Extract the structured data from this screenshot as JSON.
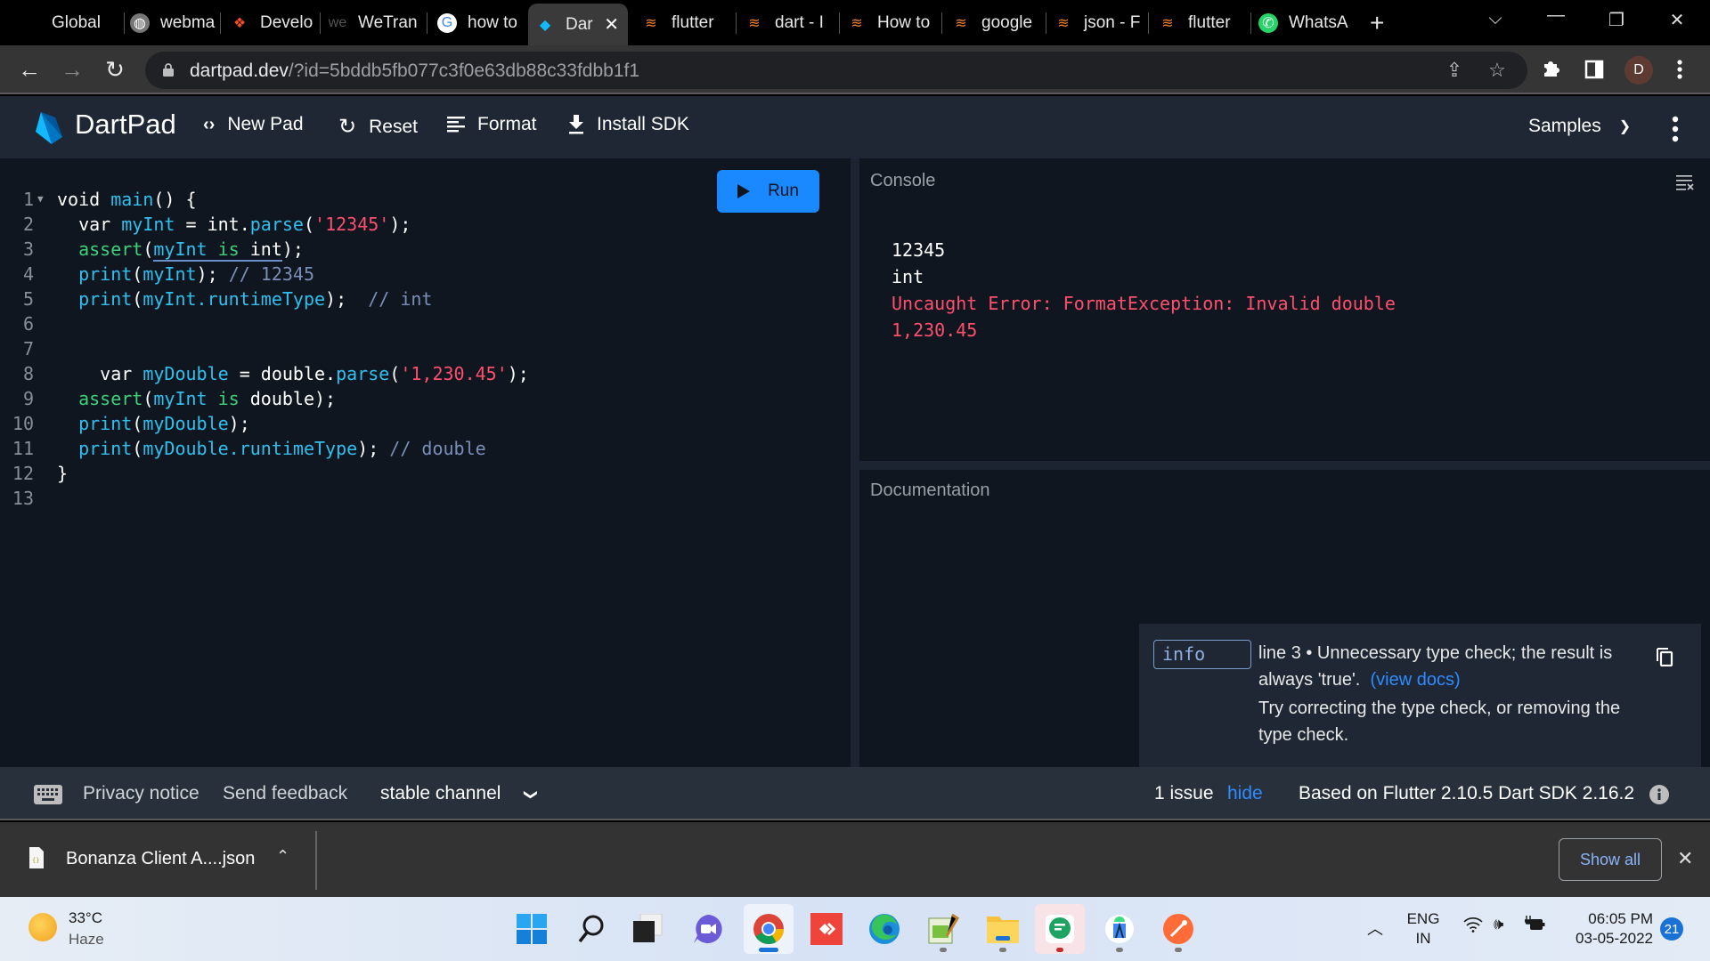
{
  "browser": {
    "tabs": [
      {
        "title": "Global",
        "icon": "none"
      },
      {
        "title": "webma",
        "icon": "globe-icon"
      },
      {
        "title": "Develo",
        "icon": "figma-icon"
      },
      {
        "title": "WeTran",
        "icon": "wetransfer-icon"
      },
      {
        "title": "how to",
        "icon": "google-icon"
      },
      {
        "title": "Dar",
        "icon": "dart-icon",
        "active": true
      },
      {
        "title": "flutter",
        "icon": "stackoverflow-icon"
      },
      {
        "title": "dart - I",
        "icon": "stackoverflow-icon"
      },
      {
        "title": "How to",
        "icon": "stackoverflow-icon"
      },
      {
        "title": "google",
        "icon": "stackoverflow-icon"
      },
      {
        "title": "json - F",
        "icon": "stackoverflow-icon"
      },
      {
        "title": "flutter",
        "icon": "stackoverflow-icon"
      },
      {
        "title": "WhatsA",
        "icon": "whatsapp-icon"
      }
    ],
    "new_tab": "+",
    "url_host": "dartpad.dev",
    "url_rest": "/?id=5bddb5fb077c3f0e63db88c33fdbb1f1",
    "profile_initial": "D"
  },
  "header": {
    "app_name": "DartPad",
    "buttons": {
      "new_pad": "New Pad",
      "reset": "Reset",
      "format": "Format",
      "install_sdk": "Install SDK"
    },
    "samples": "Samples"
  },
  "editor": {
    "run_label": "Run",
    "line_numbers": [
      "1",
      "2",
      "3",
      "4",
      "5",
      "6",
      "7",
      "8",
      "9",
      "10",
      "11",
      "12",
      "13"
    ],
    "lines": [
      [
        {
          "t": "void ",
          "c": "kw"
        },
        {
          "t": "main",
          "c": "fn"
        },
        {
          "t": "() {",
          "c": "kw"
        }
      ],
      [
        {
          "t": "  var ",
          "c": "kw"
        },
        {
          "t": "myInt",
          "c": "id"
        },
        {
          "t": " = int.",
          "c": "kw"
        },
        {
          "t": "parse",
          "c": "fn"
        },
        {
          "t": "(",
          "c": "kw"
        },
        {
          "t": "'12345'",
          "c": "str"
        },
        {
          "t": ");",
          "c": "kw"
        }
      ],
      [
        {
          "t": "  ",
          "c": "kw"
        },
        {
          "t": "assert",
          "c": "as"
        },
        {
          "t": "(",
          "c": "kw"
        },
        {
          "t": "myInt ",
          "c": "id sq"
        },
        {
          "t": "is ",
          "c": "as sq"
        },
        {
          "t": "int",
          "c": "kw sq"
        },
        {
          "t": ");",
          "c": "kw"
        }
      ],
      [
        {
          "t": "  print",
          "c": "fn"
        },
        {
          "t": "(",
          "c": "kw"
        },
        {
          "t": "myInt",
          "c": "id"
        },
        {
          "t": "); ",
          "c": "kw"
        },
        {
          "t": "// 12345",
          "c": "cm"
        }
      ],
      [
        {
          "t": "  print",
          "c": "fn"
        },
        {
          "t": "(",
          "c": "kw"
        },
        {
          "t": "myInt.runtimeType",
          "c": "id"
        },
        {
          "t": ");  ",
          "c": "kw"
        },
        {
          "t": "// int",
          "c": "cm"
        }
      ],
      [],
      [],
      [
        {
          "t": "    var ",
          "c": "kw"
        },
        {
          "t": "myDouble",
          "c": "id"
        },
        {
          "t": " = double.",
          "c": "kw"
        },
        {
          "t": "parse",
          "c": "fn"
        },
        {
          "t": "(",
          "c": "kw"
        },
        {
          "t": "'1,230.45'",
          "c": "str"
        },
        {
          "t": ");",
          "c": "kw"
        }
      ],
      [
        {
          "t": "  ",
          "c": "kw"
        },
        {
          "t": "assert",
          "c": "as"
        },
        {
          "t": "(",
          "c": "kw"
        },
        {
          "t": "myInt ",
          "c": "id"
        },
        {
          "t": "is ",
          "c": "as"
        },
        {
          "t": "double);",
          "c": "kw"
        }
      ],
      [
        {
          "t": "  print",
          "c": "fn"
        },
        {
          "t": "(",
          "c": "kw"
        },
        {
          "t": "myDouble",
          "c": "id"
        },
        {
          "t": ");",
          "c": "kw"
        }
      ],
      [
        {
          "t": "  print",
          "c": "fn"
        },
        {
          "t": "(",
          "c": "kw"
        },
        {
          "t": "myDouble.runtimeType",
          "c": "id"
        },
        {
          "t": "); ",
          "c": "kw"
        },
        {
          "t": "// double",
          "c": "cm"
        }
      ],
      [
        {
          "t": "}",
          "c": "kw"
        }
      ],
      []
    ]
  },
  "console": {
    "title": "Console",
    "output": [
      {
        "text": "12345",
        "error": false
      },
      {
        "text": "int",
        "error": false
      },
      {
        "text": "Uncaught Error: FormatException: Invalid double",
        "error": true
      },
      {
        "text": "1,230.45",
        "error": true
      }
    ]
  },
  "documentation": {
    "title": "Documentation"
  },
  "issue": {
    "severity": "info",
    "message": "line 3 • Unnecessary type check; the result is always 'true'.",
    "link_label": "(view docs)",
    "fix": "Try correcting the type check, or removing the type check."
  },
  "footer": {
    "privacy": "Privacy notice",
    "feedback": "Send feedback",
    "channel": "stable channel",
    "issue_count": "1 issue",
    "hide": "hide",
    "version": "Based on Flutter 2.10.5 Dart SDK 2.16.2"
  },
  "downloads": {
    "file": "Bonanza Client A....json",
    "show_all": "Show all"
  },
  "taskbar": {
    "weather_temp": "33°C",
    "weather_desc": "Haze",
    "lang_1": "ENG",
    "lang_2": "IN",
    "time": "06:05 PM",
    "date": "03-05-2022",
    "notifications": "21"
  },
  "colors": {
    "accent": "#1a88ff",
    "error": "#ff4f6d",
    "header_bg": "#1e2733",
    "editor_bg": "#0f1620"
  }
}
